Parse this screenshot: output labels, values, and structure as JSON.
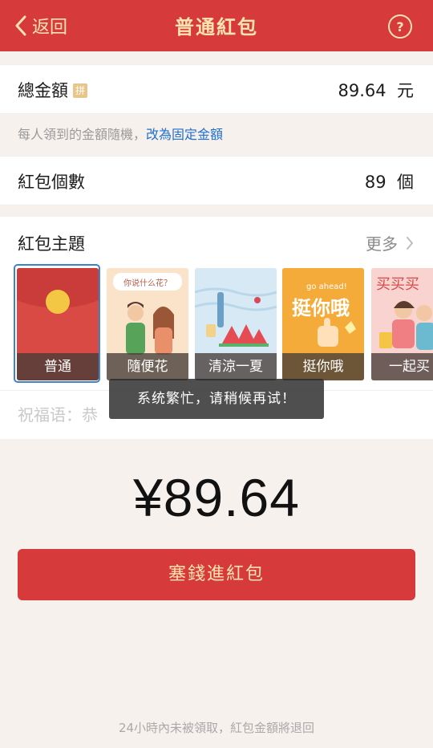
{
  "header": {
    "back_label": "返回",
    "title": "普通紅包",
    "help_label": "?"
  },
  "total": {
    "label": "總金額",
    "badge": "拼",
    "value": "89.64",
    "unit": "元"
  },
  "hint": {
    "text": "每人領到的金額隨機，",
    "link": "改為固定金額"
  },
  "count": {
    "label": "紅包個數",
    "value": "89",
    "unit": "個"
  },
  "theme": {
    "label": "紅包主題",
    "more": "更多",
    "cards": [
      {
        "caption": "普通"
      },
      {
        "caption": "隨便花",
        "art_text": "你说什么花？"
      },
      {
        "caption": "清涼一夏"
      },
      {
        "caption": "挺你哦",
        "art_text_small": "go ahead!",
        "art_text_big": "挺你哦"
      },
      {
        "caption": "一起买",
        "art_text": "买买买"
      }
    ]
  },
  "blessing": {
    "placeholder": "祝福语：恭"
  },
  "toast": "系统繁忙，请稍候再试！",
  "amount": "¥89.64",
  "send_button": "塞錢進紅包",
  "footer": "24小時內未被領取，紅包金額將退回",
  "colors": {
    "primary": "#d63a3a",
    "accent_text": "#fbe3b0",
    "link": "#1f6fd0",
    "selection": "#3d82c9"
  }
}
